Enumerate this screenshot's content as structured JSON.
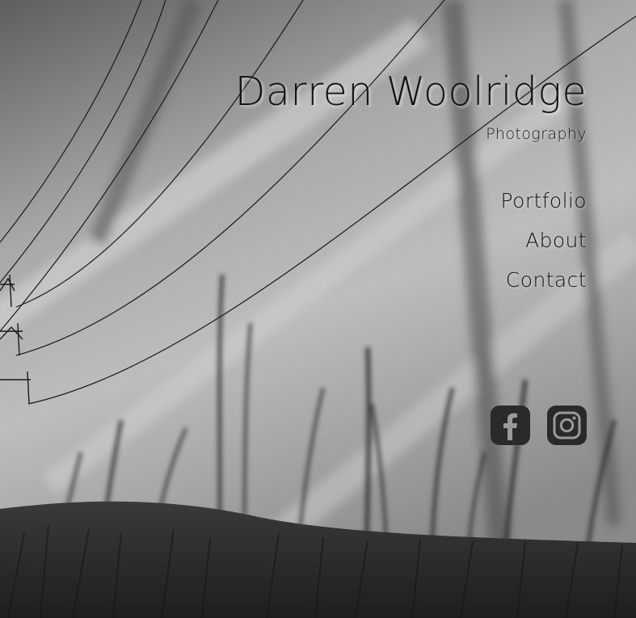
{
  "site": {
    "title": "Darren Woolridge",
    "subtitle": "Photography"
  },
  "nav": {
    "items": [
      {
        "label": "Portfolio"
      },
      {
        "label": "About"
      },
      {
        "label": "Contact"
      }
    ]
  },
  "social": {
    "icons": [
      "facebook-icon",
      "instagram-icon"
    ]
  },
  "colors": {
    "text": "#151515",
    "icon_bg": "#2a2a2a",
    "icon_fg": "#9a9a9a"
  }
}
